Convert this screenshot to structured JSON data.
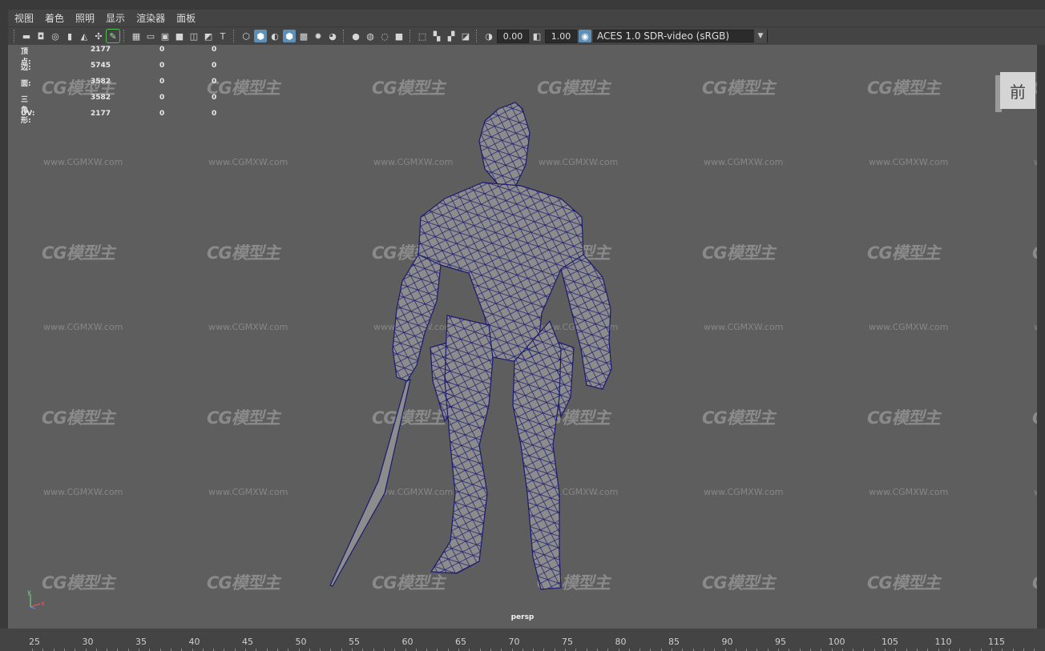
{
  "menu": [
    "视图",
    "着色",
    "照明",
    "显示",
    "渲染器",
    "面板"
  ],
  "toolbar": {
    "exposure": "0.00",
    "gamma": "1.00",
    "color_management": "ACES 1.0 SDR-video (sRGB)"
  },
  "hud": {
    "rows": [
      {
        "label": "顶点:",
        "v1": "2177",
        "v2": "0",
        "v3": "0"
      },
      {
        "label": "边:",
        "v1": "5745",
        "v2": "0",
        "v3": "0"
      },
      {
        "label": "面:",
        "v1": "3582",
        "v2": "0",
        "v3": "0"
      },
      {
        "label": "三角形:",
        "v1": "3582",
        "v2": "0",
        "v3": "0"
      },
      {
        "label": "UV:",
        "v1": "2177",
        "v2": "0",
        "v3": "0"
      }
    ]
  },
  "viewcube": {
    "face": "前"
  },
  "camera": "persp",
  "axis": {
    "y": "y",
    "x": "x"
  },
  "watermark": {
    "logo": "CG模型主",
    "url": "www.CGMXW.com"
  },
  "timeline": {
    "labels": [
      "25",
      "30",
      "35",
      "40",
      "45",
      "50",
      "55",
      "60",
      "65",
      "70",
      "75",
      "80",
      "85",
      "90",
      "95",
      "100",
      "105",
      "110",
      "115"
    ]
  },
  "colors": {
    "viewport": "#5e5e5e",
    "wire": "#1a1a70",
    "accent": "#5e8fb7"
  }
}
